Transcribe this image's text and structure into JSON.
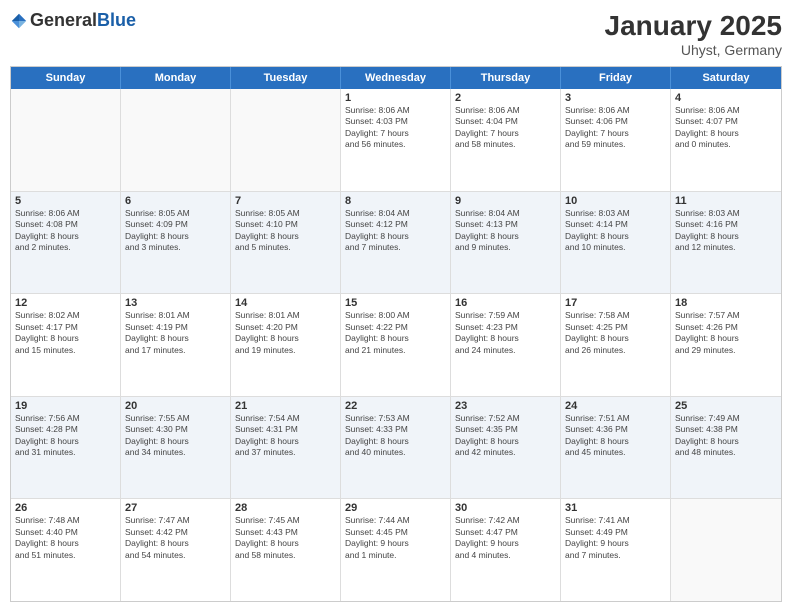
{
  "header": {
    "logo_general": "General",
    "logo_blue": "Blue",
    "title": "January 2025",
    "subtitle": "Uhyst, Germany"
  },
  "weekdays": [
    "Sunday",
    "Monday",
    "Tuesday",
    "Wednesday",
    "Thursday",
    "Friday",
    "Saturday"
  ],
  "rows": [
    {
      "cells": [
        {
          "day": "",
          "info": "",
          "empty": true
        },
        {
          "day": "",
          "info": "",
          "empty": true
        },
        {
          "day": "",
          "info": "",
          "empty": true
        },
        {
          "day": "1",
          "info": "Sunrise: 8:06 AM\nSunset: 4:03 PM\nDaylight: 7 hours\nand 56 minutes."
        },
        {
          "day": "2",
          "info": "Sunrise: 8:06 AM\nSunset: 4:04 PM\nDaylight: 7 hours\nand 58 minutes."
        },
        {
          "day": "3",
          "info": "Sunrise: 8:06 AM\nSunset: 4:06 PM\nDaylight: 7 hours\nand 59 minutes."
        },
        {
          "day": "4",
          "info": "Sunrise: 8:06 AM\nSunset: 4:07 PM\nDaylight: 8 hours\nand 0 minutes."
        }
      ]
    },
    {
      "cells": [
        {
          "day": "5",
          "info": "Sunrise: 8:06 AM\nSunset: 4:08 PM\nDaylight: 8 hours\nand 2 minutes."
        },
        {
          "day": "6",
          "info": "Sunrise: 8:05 AM\nSunset: 4:09 PM\nDaylight: 8 hours\nand 3 minutes."
        },
        {
          "day": "7",
          "info": "Sunrise: 8:05 AM\nSunset: 4:10 PM\nDaylight: 8 hours\nand 5 minutes."
        },
        {
          "day": "8",
          "info": "Sunrise: 8:04 AM\nSunset: 4:12 PM\nDaylight: 8 hours\nand 7 minutes."
        },
        {
          "day": "9",
          "info": "Sunrise: 8:04 AM\nSunset: 4:13 PM\nDaylight: 8 hours\nand 9 minutes."
        },
        {
          "day": "10",
          "info": "Sunrise: 8:03 AM\nSunset: 4:14 PM\nDaylight: 8 hours\nand 10 minutes."
        },
        {
          "day": "11",
          "info": "Sunrise: 8:03 AM\nSunset: 4:16 PM\nDaylight: 8 hours\nand 12 minutes."
        }
      ]
    },
    {
      "cells": [
        {
          "day": "12",
          "info": "Sunrise: 8:02 AM\nSunset: 4:17 PM\nDaylight: 8 hours\nand 15 minutes."
        },
        {
          "day": "13",
          "info": "Sunrise: 8:01 AM\nSunset: 4:19 PM\nDaylight: 8 hours\nand 17 minutes."
        },
        {
          "day": "14",
          "info": "Sunrise: 8:01 AM\nSunset: 4:20 PM\nDaylight: 8 hours\nand 19 minutes."
        },
        {
          "day": "15",
          "info": "Sunrise: 8:00 AM\nSunset: 4:22 PM\nDaylight: 8 hours\nand 21 minutes."
        },
        {
          "day": "16",
          "info": "Sunrise: 7:59 AM\nSunset: 4:23 PM\nDaylight: 8 hours\nand 24 minutes."
        },
        {
          "day": "17",
          "info": "Sunrise: 7:58 AM\nSunset: 4:25 PM\nDaylight: 8 hours\nand 26 minutes."
        },
        {
          "day": "18",
          "info": "Sunrise: 7:57 AM\nSunset: 4:26 PM\nDaylight: 8 hours\nand 29 minutes."
        }
      ]
    },
    {
      "cells": [
        {
          "day": "19",
          "info": "Sunrise: 7:56 AM\nSunset: 4:28 PM\nDaylight: 8 hours\nand 31 minutes."
        },
        {
          "day": "20",
          "info": "Sunrise: 7:55 AM\nSunset: 4:30 PM\nDaylight: 8 hours\nand 34 minutes."
        },
        {
          "day": "21",
          "info": "Sunrise: 7:54 AM\nSunset: 4:31 PM\nDaylight: 8 hours\nand 37 minutes."
        },
        {
          "day": "22",
          "info": "Sunrise: 7:53 AM\nSunset: 4:33 PM\nDaylight: 8 hours\nand 40 minutes."
        },
        {
          "day": "23",
          "info": "Sunrise: 7:52 AM\nSunset: 4:35 PM\nDaylight: 8 hours\nand 42 minutes."
        },
        {
          "day": "24",
          "info": "Sunrise: 7:51 AM\nSunset: 4:36 PM\nDaylight: 8 hours\nand 45 minutes."
        },
        {
          "day": "25",
          "info": "Sunrise: 7:49 AM\nSunset: 4:38 PM\nDaylight: 8 hours\nand 48 minutes."
        }
      ]
    },
    {
      "cells": [
        {
          "day": "26",
          "info": "Sunrise: 7:48 AM\nSunset: 4:40 PM\nDaylight: 8 hours\nand 51 minutes."
        },
        {
          "day": "27",
          "info": "Sunrise: 7:47 AM\nSunset: 4:42 PM\nDaylight: 8 hours\nand 54 minutes."
        },
        {
          "day": "28",
          "info": "Sunrise: 7:45 AM\nSunset: 4:43 PM\nDaylight: 8 hours\nand 58 minutes."
        },
        {
          "day": "29",
          "info": "Sunrise: 7:44 AM\nSunset: 4:45 PM\nDaylight: 9 hours\nand 1 minute."
        },
        {
          "day": "30",
          "info": "Sunrise: 7:42 AM\nSunset: 4:47 PM\nDaylight: 9 hours\nand 4 minutes."
        },
        {
          "day": "31",
          "info": "Sunrise: 7:41 AM\nSunset: 4:49 PM\nDaylight: 9 hours\nand 7 minutes."
        },
        {
          "day": "",
          "info": "",
          "empty": true
        }
      ]
    }
  ]
}
